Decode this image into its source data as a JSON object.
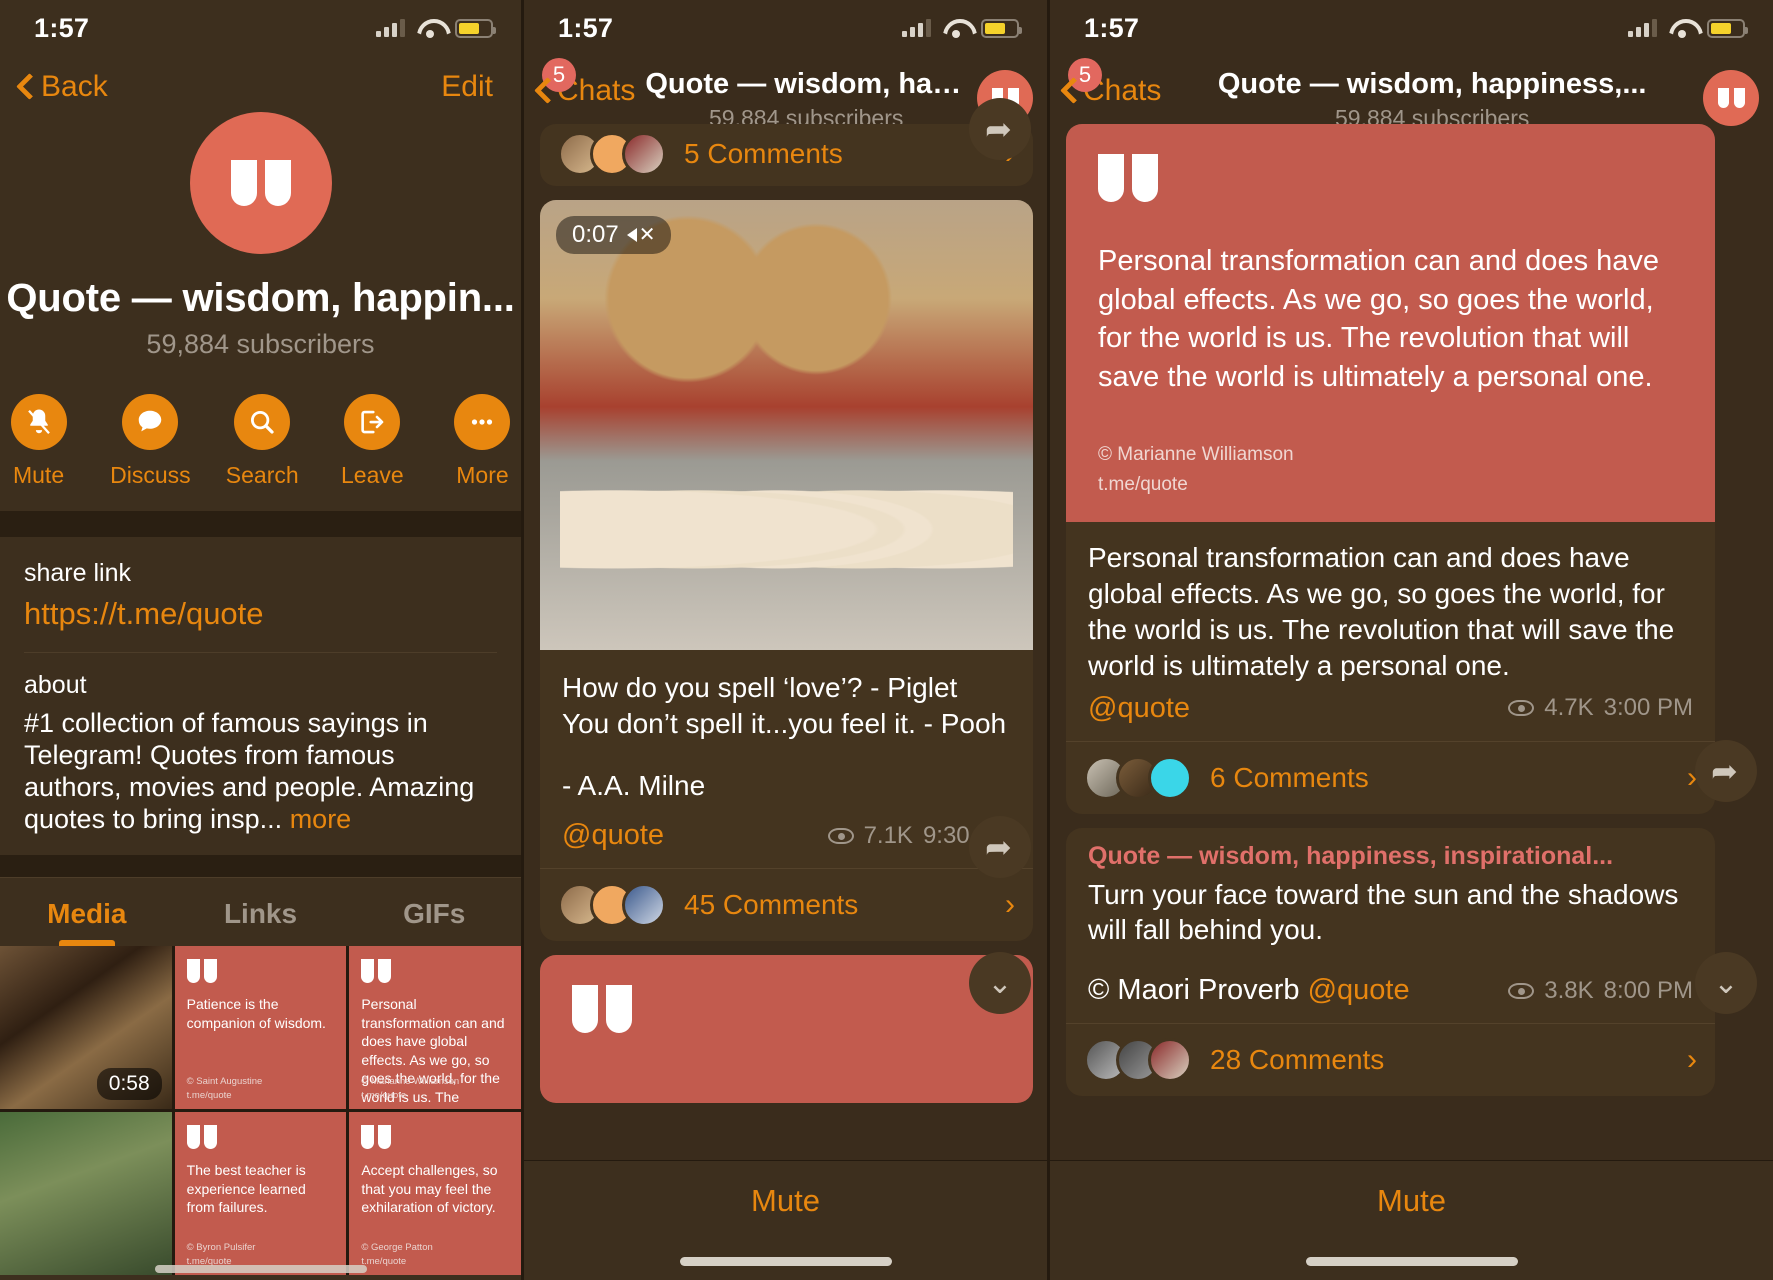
{
  "status": {
    "time": "1:57"
  },
  "left": {
    "nav": {
      "back": "Back",
      "edit": "Edit"
    },
    "profile": {
      "name": "Quote — wisdom, happin...",
      "subscribers": "59,884 subscribers"
    },
    "actions": [
      {
        "label": "Mute",
        "icon": "bell-muted-icon"
      },
      {
        "label": "Discuss",
        "icon": "chat-bubble-icon"
      },
      {
        "label": "Search",
        "icon": "search-icon"
      },
      {
        "label": "Leave",
        "icon": "leave-icon"
      },
      {
        "label": "More",
        "icon": "ellipsis-icon"
      }
    ],
    "share": {
      "label": "share link",
      "value": "https://t.me/quote"
    },
    "about": {
      "label": "about",
      "text": "#1 collection of famous sayings in Telegram! Quotes from famous authors, movies and people. Amazing quotes to bring insp...",
      "more": "more"
    },
    "tabs": [
      {
        "label": "Media",
        "active": true
      },
      {
        "label": "Links",
        "active": false
      },
      {
        "label": "GIFs",
        "active": false
      }
    ],
    "media": [
      {
        "type": "video",
        "duration": "0:58"
      },
      {
        "type": "quote",
        "text": "Patience is the companion of wisdom.",
        "attr": "© Saint Augustine",
        "src": "t.me/quote"
      },
      {
        "type": "quote",
        "text": "Personal transformation can and does have global effects. As we go, so goes the world, for the world is us. The revolution that will save the world is ultimately a personal one.",
        "attr": "© Marianne Williamson",
        "src": "t.me/quote"
      },
      {
        "type": "photo"
      },
      {
        "type": "quote",
        "text": "The best teacher is experience learned from failures.",
        "attr": "© Byron Pulsifer",
        "src": "t.me/quote"
      },
      {
        "type": "quote",
        "text": "Accept challenges, so that you may feel the exhilaration of victory.",
        "attr": "© George Patton",
        "src": "t.me/quote"
      }
    ]
  },
  "mid": {
    "nav": {
      "back": "Chats",
      "badge": "5",
      "title": "Quote — wisdom, happiness,...",
      "subtitle": "59,884 subscribers"
    },
    "top_comments": "5 Comments",
    "message": {
      "video_duration": "0:07",
      "line1": "How do you spell ‘love’? - Piglet",
      "line2": "You don’t spell it...you feel it. - Pooh",
      "line3": "- A.A. Milne",
      "handle": "@quote",
      "views": "7.1K",
      "time": "9:30 AM",
      "comments": "45 Comments"
    },
    "mute": "Mute"
  },
  "right": {
    "nav": {
      "back": "Chats",
      "badge": "5",
      "title": "Quote — wisdom, happiness,...",
      "subtitle": "59,884 subscribers"
    },
    "card": {
      "text": "Personal transformation can and does have global effects. As we go, so goes the world, for the world is us. The revolution that will save the world is ultimately a personal one.",
      "attr": "© Marianne Williamson",
      "src": "t.me/quote"
    },
    "message1": {
      "text": "Personal transformation can and does have global effects. As we go, so goes the world, for the world is us. The revolution that will save the world is ultimately a personal one.",
      "handle": "@quote",
      "views": "4.7K",
      "time": "3:00 PM",
      "comments": "6 Comments"
    },
    "message2": {
      "forward_from": "Quote — wisdom, happiness, inspirational...",
      "text": "Turn your face toward the sun and the shadows will fall behind you.",
      "attr": "© Maori Proverb",
      "handle": "@quote",
      "views": "3.8K",
      "time": "8:00 PM",
      "comments": "28 Comments"
    },
    "mute": "Mute"
  }
}
